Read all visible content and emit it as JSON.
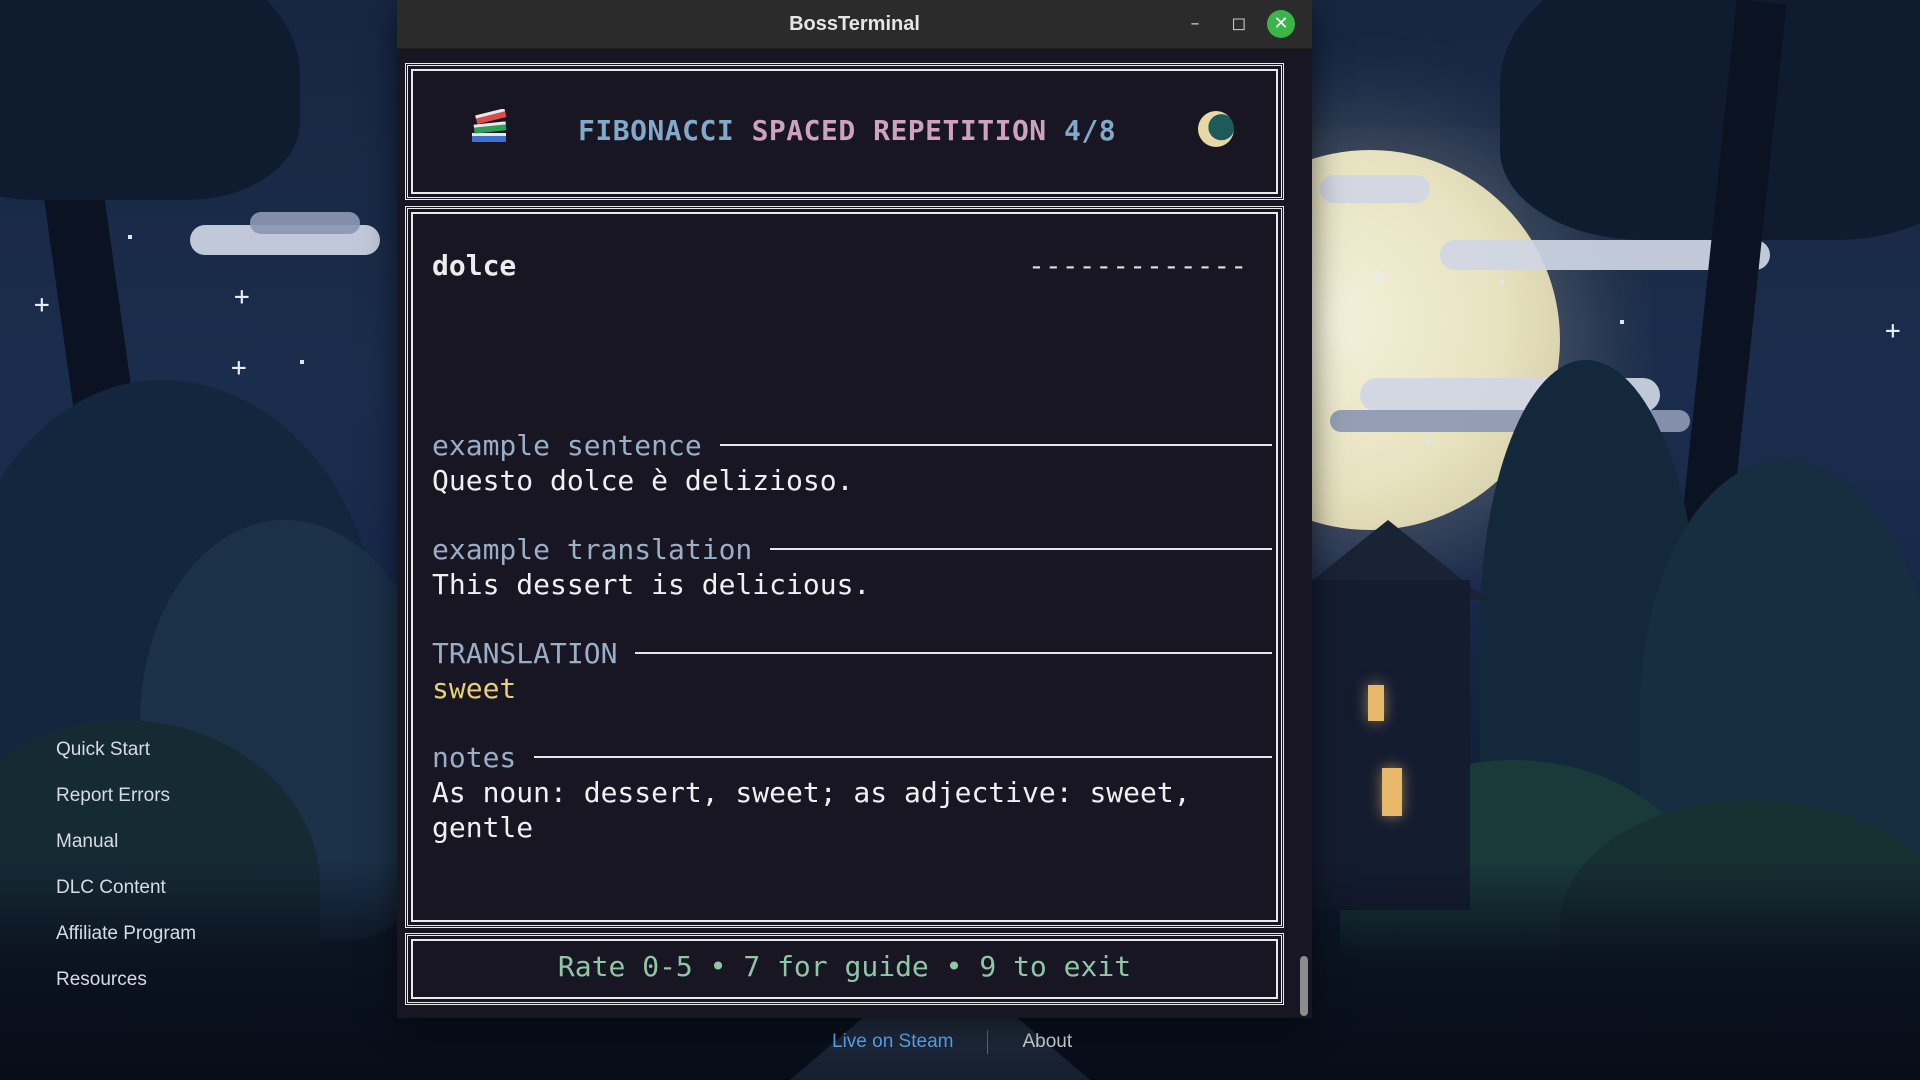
{
  "window": {
    "title": "BossTerminal"
  },
  "header": {
    "title_part1": "FIBONACCI",
    "title_part2": "SPACED REPETITION",
    "title_part3": "4/8"
  },
  "card": {
    "word": "dolce",
    "answer_mask": "-------------",
    "sections": [
      {
        "label": "example sentence",
        "text": "Questo dolce è delizioso."
      },
      {
        "label": "example translation",
        "text": "This dessert is delicious."
      },
      {
        "label": "TRANSLATION",
        "text": "sweet"
      },
      {
        "label": "notes",
        "text_line1": "As noun: dessert, sweet; as adjective: sweet,",
        "text_line2": "gentle"
      }
    ]
  },
  "prompt": "Rate 0-5 • 7 for guide • 9 to exit",
  "sidebar": {
    "items": [
      "Quick Start",
      "Report Errors",
      "Manual",
      "DLC Content",
      "Affiliate Program",
      "Resources"
    ]
  },
  "footer": {
    "steam": "Live on Steam",
    "about": "About"
  },
  "colors": {
    "accent_blue": "#82a9c9",
    "accent_pink": "#cda3bb",
    "translation_yellow": "#e6cf76",
    "prompt_green": "#8fc7a6",
    "close_green": "#39b54a",
    "steam_blue": "#5aa6ef"
  },
  "icons": [
    "books-icon",
    "crescent-moon-icon",
    "minimize-icon",
    "maximize-icon",
    "close-icon"
  ]
}
